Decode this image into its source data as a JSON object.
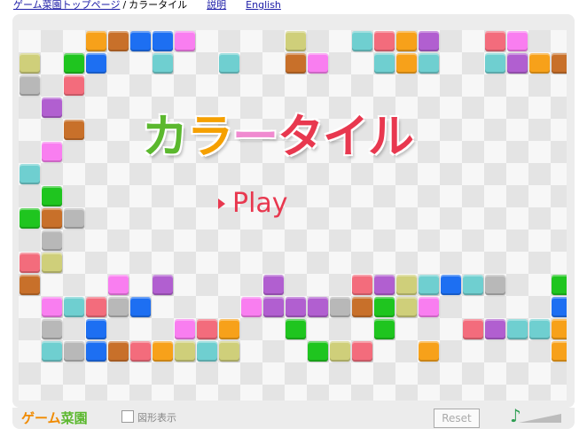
{
  "nav": {
    "home_link": "ゲーム菜園トップページ",
    "separator": "/",
    "current": "カラータイル",
    "help_link": "説明",
    "english_link": "English"
  },
  "game": {
    "title_part1": "カ",
    "title_part2": "ラ",
    "title_part3": "ー",
    "title_part4": "タイル",
    "play_label": "Play"
  },
  "footer": {
    "brand_part1": "ゲーム",
    "brand_part2": "菜園",
    "show_shapes_label": "図形表示",
    "reset_label": "Reset"
  },
  "colors": {
    "O": "#f7a11a",
    "B": "#c8702a",
    "U": "#1d6ff2",
    "P": "#f97ef0",
    "Y": "#cfcf7a",
    "C": "#6fcfd0",
    "R": "#f36c7c",
    "V": "#b15fd0",
    "G": "#1fc51f",
    "S": "#b8b8b8"
  },
  "tiles": [
    "...OBUUP....Y..CROV..RP....UP",
    "Y.GU..C..C..BP..COC..CVOB..Y",
    "S.R...........................V.",
    ".V...........................Y",
    "..B..........................B",
    ".P.............................",
    "C.............................",
    ".G...........................UO",
    "GBS..........................Y",
    ".S..........................C.",
    "RY..........................OS",
    "B...P.V....V...RVYCUCS..GP",
    ".PCRSU....PVVVSBGYP.....UY",
    ".S.U...PRO..G...G...RVCCOG",
    ".CSUBROYCY...GYR..O.....O"
  ]
}
